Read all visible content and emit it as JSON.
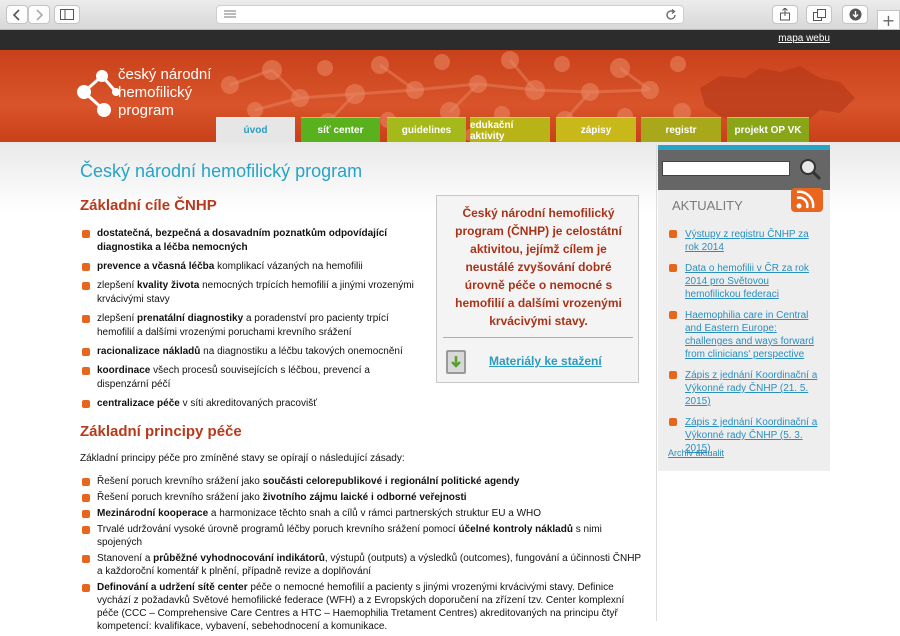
{
  "topbar": {
    "sitemap": "mapa webu"
  },
  "logo": {
    "line1": "český národní",
    "line2": "hemofilický",
    "line3": "program"
  },
  "nav": {
    "tabs": [
      {
        "label": "úvod",
        "color": "#e6e6e6",
        "text": "#2a9cc0"
      },
      {
        "label": "síť center",
        "color": "#59b21d",
        "text": "#ffffff"
      },
      {
        "label": "guidelines",
        "color": "#a5b91a",
        "text": "#ffffff"
      },
      {
        "label": "edukační aktivity",
        "color": "#b8b317",
        "text": "#ffffff"
      },
      {
        "label": "zápisy",
        "color": "#c8b81a",
        "text": "#ffffff"
      },
      {
        "label": "registr",
        "color": "#a8a81a",
        "text": "#ffffff"
      },
      {
        "label": "projekt OP VK",
        "color": "#8aa518",
        "text": "#ffffff"
      }
    ]
  },
  "main": {
    "title": "Český národní hemofilický program",
    "goals_heading": "Základní cíle ČNHP",
    "goals": [
      {
        "pre": "",
        "bold": "dostatečná, bezpečná a dosavadním poznatkům odpovídající diagnostika a léčba nemocných",
        "post": ""
      },
      {
        "pre": "",
        "bold": "prevence a včasná léčba",
        "post": " komplikací vázaných na hemofilii"
      },
      {
        "pre": "zlepšení ",
        "bold": "kvality života",
        "post": " nemocných trpících hemofilií a jinými vrozenými krvácivými stavy"
      },
      {
        "pre": "zlepšení ",
        "bold": "prenatální diagnostiky",
        "post": " a poradenství pro pacienty trpící hemofilií a dalšími vrozenými poruchami krevního srážení"
      },
      {
        "pre": "",
        "bold": "racionalizace nákladů",
        "post": " na diagnostiku a léčbu takových onemocnění"
      },
      {
        "pre": "",
        "bold": "koordinace",
        "post": " všech procesů souvisejících s léčbou, prevencí a dispenzární péčí"
      },
      {
        "pre": "",
        "bold": "centralizace péče",
        "post": " v síti akreditovaných pracovišť"
      }
    ],
    "principles_heading": "Základní principy péče",
    "principles_intro": "Základní principy péče pro zmíněné stavy se opírají o následující zásady:",
    "principles": [
      {
        "pre": "Řešení poruch krevního srážení jako ",
        "bold": "součásti celorepublikové i regionální politické agendy",
        "post": ""
      },
      {
        "pre": "Řešení poruch krevního srážení jako ",
        "bold": "životního zájmu laické i odborné veřejnosti",
        "post": ""
      },
      {
        "pre": "",
        "bold": "Mezinárodní kooperace",
        "post": " a harmonizace těchto snah a cílů v rámci partnerských struktur EU a WHO"
      },
      {
        "pre": "Trvalé udržování vysoké úrovně programů léčby poruch krevního srážení pomocí ",
        "bold": "účelné kontroly nákladů",
        "post": " s nimi spojených"
      },
      {
        "pre": "Stanovení a ",
        "bold": "průběžné vyhodnocování indikátorů",
        "post": ", výstupů (outputs) a výsledků (outcomes), fungování a účinnosti ČNHP a každoroční komentář k plnění, případně revize a doplňování"
      },
      {
        "pre": "",
        "bold": "Definování a udržení sítě center",
        "post": " péče o nemocné hemofilií a pacienty s jinými vrozenými krvácivými stavy. Definice vychází z požadavků Světové hemofilické federace (WFH) a z Evropských doporučení na zřízení tzv. Center komplexní péče (CCC – Comprehensive Care Centres a HTC – Haemophilia Tretament Centres) akreditovaných na principu čtyř kompetencí: kvalifikace, vybavení, sebehodnocení a komunikace."
      }
    ]
  },
  "infobox": {
    "text": "Český národní hemofilický program (ČNHP) je celostátní aktivitou, jejímž cílem je neustálé zvyšování dobré úrovně péče o nemocné s hemofilií a dalšími vrozenými krvácivými stavy.",
    "download_link": "Materiály ke stažení"
  },
  "sidebar": {
    "search_placeholder": "",
    "title": "AKTUALITY",
    "news": [
      "Výstupy z registru ČNHP za rok 2014",
      "Data o hemofilii v ČR za rok 2014 pro Světovou hemofilickou federaci",
      "Haemophilia care in Central and Eastern Europe: challenges and ways forward from clinicians' perspective",
      "Zápis z jednání Koordinační a Výkonné rady ČNHP (21. 5. 2015)",
      "Zápis z jednání Koordinační a Výkonné rady ČNHP (5. 3. 2015)"
    ],
    "archive": "Archiv aktualit"
  }
}
